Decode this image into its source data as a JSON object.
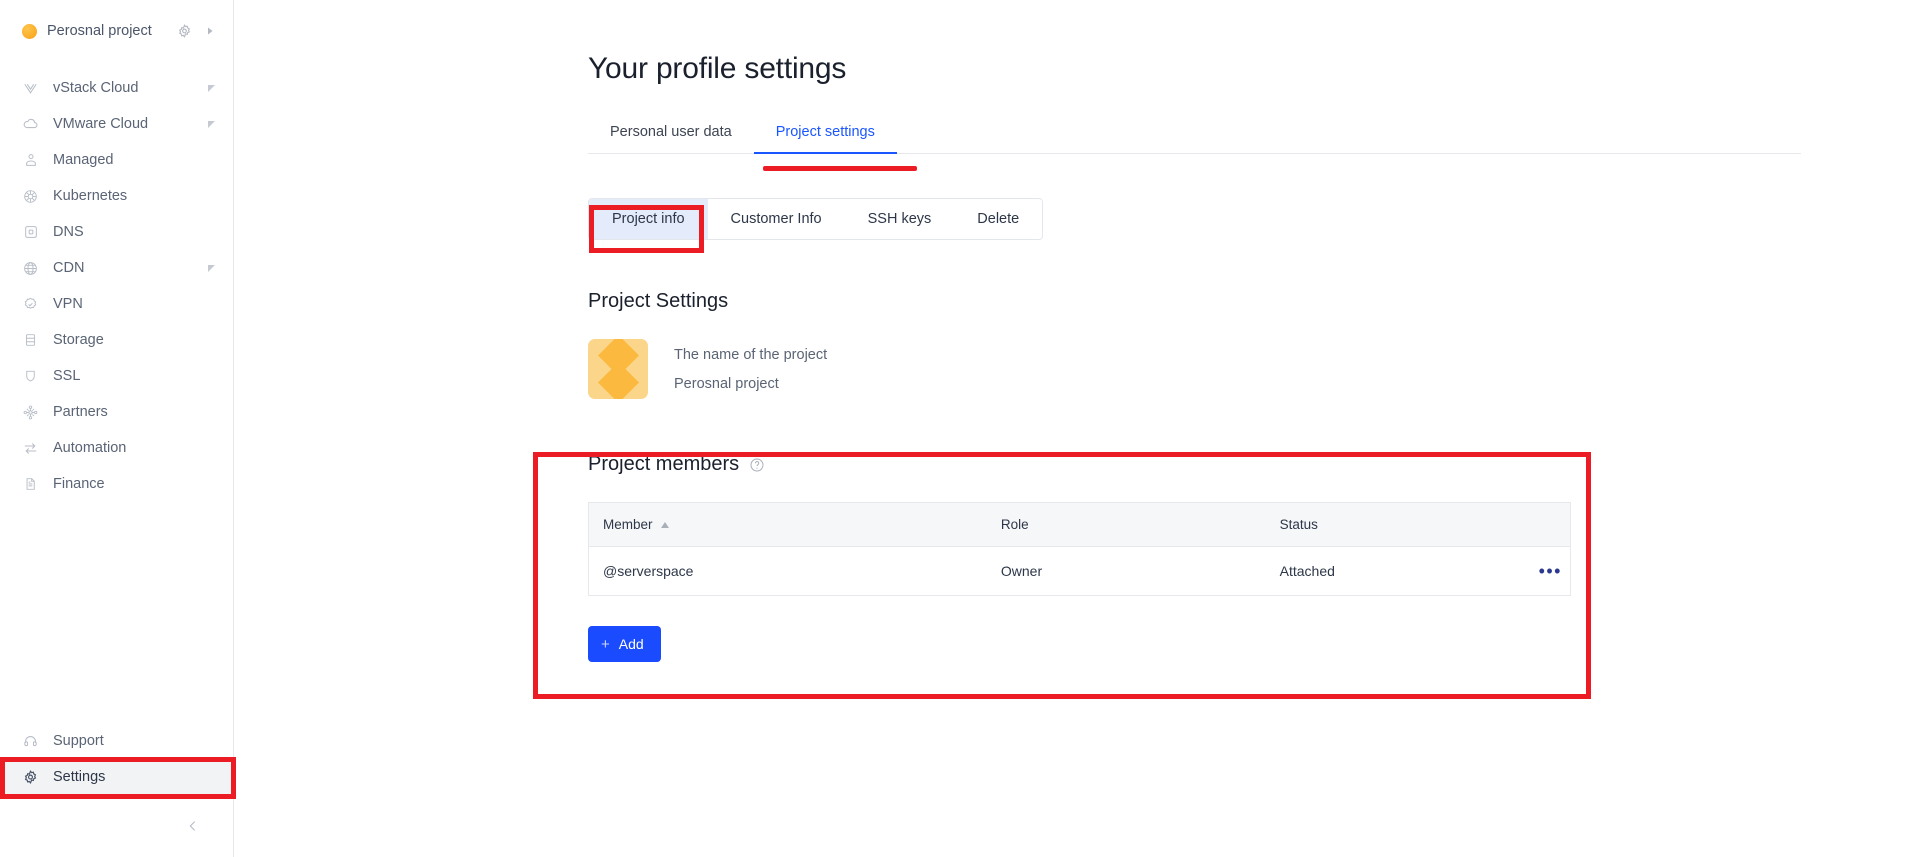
{
  "sidebar": {
    "project": {
      "name": "Perosnal project",
      "dot_color": "#fbab24",
      "gear_icon": "gear-icon",
      "expand_icon": "caret-right-icon"
    },
    "items": [
      {
        "label": "vStack Cloud",
        "icon": "vstack-icon",
        "expandable": true
      },
      {
        "label": "VMware Cloud",
        "icon": "cloud-icon",
        "expandable": true
      },
      {
        "label": "Managed",
        "icon": "managed-icon",
        "expandable": false
      },
      {
        "label": "Kubernetes",
        "icon": "kubernetes-icon",
        "expandable": false
      },
      {
        "label": "DNS",
        "icon": "dns-icon",
        "expandable": false
      },
      {
        "label": "CDN",
        "icon": "globe-icon",
        "expandable": true
      },
      {
        "label": "VPN",
        "icon": "vpn-badge-icon",
        "expandable": false
      },
      {
        "label": "Storage",
        "icon": "database-icon",
        "expandable": false
      },
      {
        "label": "SSL",
        "icon": "shield-icon",
        "expandable": false
      },
      {
        "label": "Partners",
        "icon": "partners-icon",
        "expandable": false
      },
      {
        "label": "Automation",
        "icon": "automation-icon",
        "expandable": false
      },
      {
        "label": "Finance",
        "icon": "document-icon",
        "expandable": false
      }
    ],
    "bottom_items": [
      {
        "label": "Support",
        "icon": "headset-icon",
        "active": false
      },
      {
        "label": "Settings",
        "icon": "gear-icon",
        "active": true
      }
    ],
    "collapse_icon": "chevron-left-icon"
  },
  "main": {
    "title": "Your profile settings",
    "tabs": [
      {
        "label": "Personal user data",
        "active": false
      },
      {
        "label": "Project settings",
        "active": true
      }
    ],
    "subtabs": [
      {
        "label": "Project info",
        "active": true
      },
      {
        "label": "Customer Info",
        "active": false
      },
      {
        "label": "SSH keys",
        "active": false
      },
      {
        "label": "Delete",
        "active": false
      }
    ],
    "project_settings": {
      "section_title": "Project Settings",
      "avatar_bg": "#fbd68a",
      "avatar_diamond": "#fbb93f",
      "name_label": "The name of the project",
      "name_value": "Perosnal project"
    },
    "members": {
      "section_title": "Project members",
      "help_icon": "question-circle-icon",
      "columns": [
        {
          "label": "Member",
          "sort": "asc"
        },
        {
          "label": "Role",
          "sort": null
        },
        {
          "label": "Status",
          "sort": null
        },
        {
          "label": "",
          "sort": null
        }
      ],
      "rows": [
        {
          "member": "@serverspace",
          "role": "Owner",
          "status": "Attached",
          "menu": "•••"
        }
      ],
      "add_button": {
        "label": "Add",
        "plus": "+",
        "color": "#1a4bff"
      }
    }
  },
  "annotations": {
    "color": "#ec1c24",
    "highlights": [
      "settings-sidebar-item",
      "project-settings-tab-underline",
      "project-info-subtab",
      "project-members-section"
    ]
  }
}
